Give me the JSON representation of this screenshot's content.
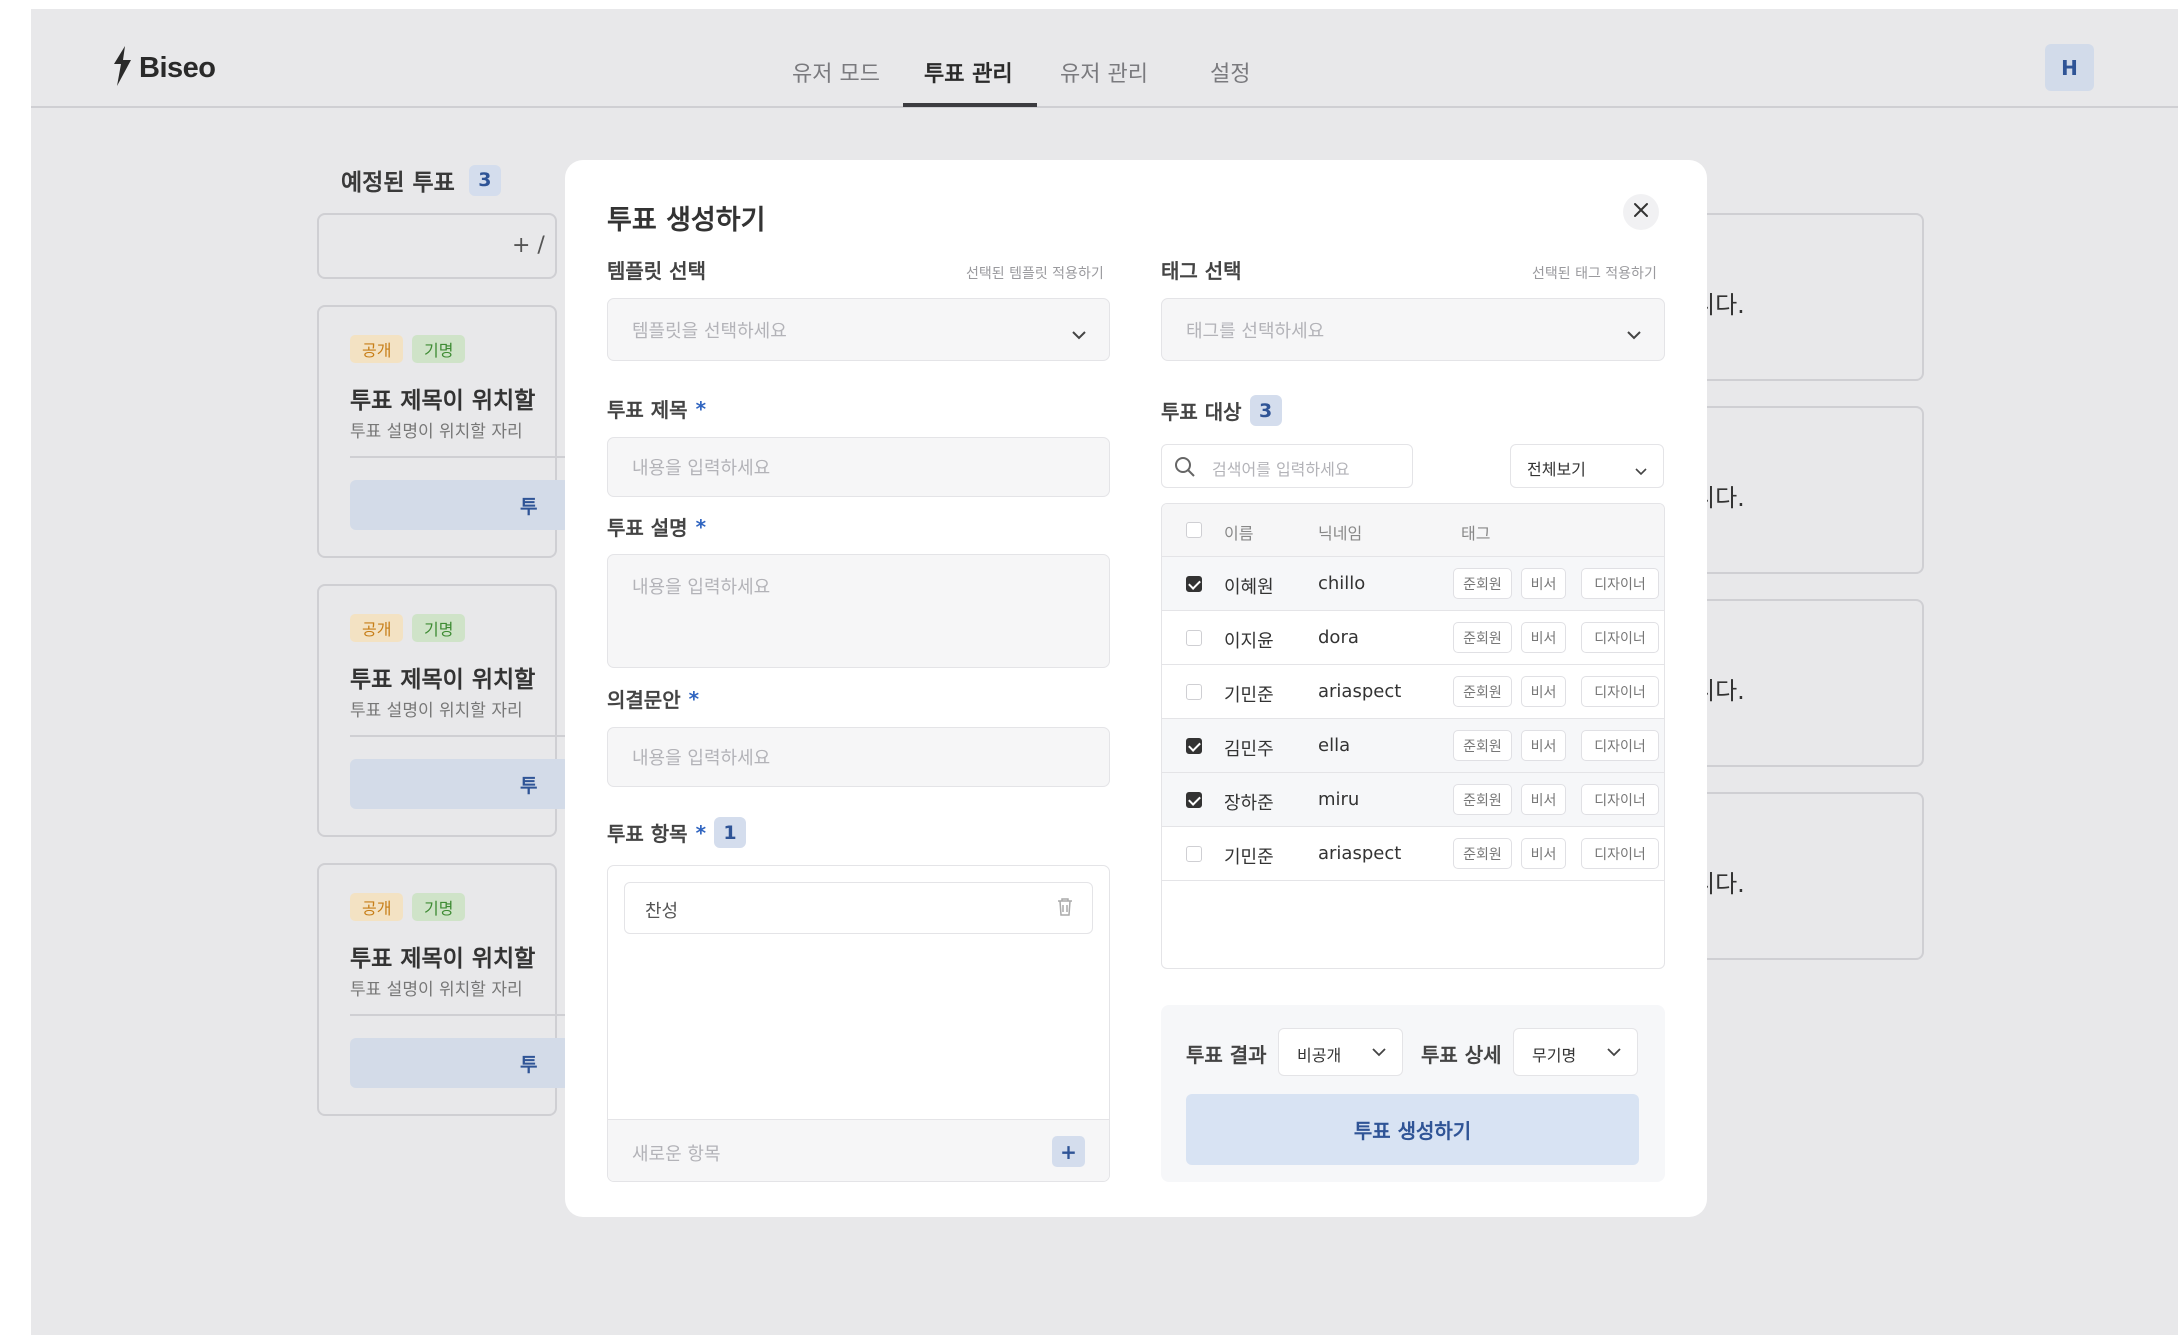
{
  "app": {
    "logo_text": "Biseo",
    "avatar_initial": "H"
  },
  "nav": {
    "tabs": [
      {
        "label": "유저 모드",
        "active": false
      },
      {
        "label": "투표 관리",
        "active": true
      },
      {
        "label": "유저 관리",
        "active": false
      },
      {
        "label": "설정",
        "active": false
      }
    ]
  },
  "background": {
    "heading": "예정된 투표",
    "heading_count": "3",
    "add_label": "+ /",
    "cards": [
      {
        "tag_public": "공개",
        "tag_anon": "기명",
        "title": "투표 제목이 위치할",
        "desc": "투표 설명이 위치할 자리",
        "button": "투"
      },
      {
        "tag_public": "공개",
        "tag_anon": "기명",
        "title": "투표 제목이 위치할",
        "desc": "투표 설명이 위치할 자리",
        "button": "투"
      },
      {
        "tag_public": "공개",
        "tag_anon": "기명",
        "title": "투표 제목이 위치할",
        "desc": "투표 설명이 위치할 자리",
        "button": "투"
      }
    ],
    "right_cards": [
      {
        "text": "니다."
      },
      {
        "text": "니다."
      },
      {
        "text": "니다."
      },
      {
        "text": "니다."
      }
    ]
  },
  "modal": {
    "title": "투표 생성하기",
    "template": {
      "label": "템플릿 선택",
      "apply_link": "선택된 템플릿 적용하기",
      "placeholder": "템플릿을 선택하세요"
    },
    "vote_title": {
      "label": "투표 제목",
      "required": "*",
      "placeholder": "내용을 입력하세요"
    },
    "vote_desc": {
      "label": "투표 설명",
      "required": "*",
      "placeholder": "내용을 입력하세요"
    },
    "resolution": {
      "label": "의결문안",
      "required": "*",
      "placeholder": "내용을 입력하세요"
    },
    "options": {
      "label": "투표 항목",
      "required": "*",
      "count": "1",
      "items": [
        "찬성"
      ],
      "new_placeholder": "새로운 항목",
      "add_button": "+"
    },
    "tag_select": {
      "label": "태그 선택",
      "apply_link": "선택된 태그 적용하기",
      "placeholder": "태그를 선택하세요"
    },
    "targets": {
      "label": "투표 대상",
      "count": "3",
      "search_placeholder": "검색어를 입력하세요",
      "filter_value": "전체보기",
      "columns": [
        "이름",
        "닉네임",
        "태그"
      ],
      "rows": [
        {
          "name": "이혜원",
          "nickname": "chillo",
          "checked": true,
          "tags": [
            "준회원",
            "비서",
            "디자이너"
          ]
        },
        {
          "name": "이지윤",
          "nickname": "dora",
          "checked": false,
          "tags": [
            "준회원",
            "비서",
            "디자이너"
          ]
        },
        {
          "name": "기민준",
          "nickname": "ariaspect",
          "checked": false,
          "tags": [
            "준회원",
            "비서",
            "디자이너"
          ]
        },
        {
          "name": "김민주",
          "nickname": "ella",
          "checked": true,
          "tags": [
            "준회원",
            "비서",
            "디자이너"
          ]
        },
        {
          "name": "장하준",
          "nickname": "miru",
          "checked": true,
          "tags": [
            "준회원",
            "비서",
            "디자이너"
          ]
        },
        {
          "name": "기민준",
          "nickname": "ariaspect",
          "checked": false,
          "tags": [
            "준회원",
            "비서",
            "디자이너"
          ]
        }
      ]
    },
    "result": {
      "label": "투표 결과",
      "value": "비공개"
    },
    "detail": {
      "label": "투표 상세",
      "value": "무기명"
    },
    "submit_label": "투표 생성하기"
  }
}
